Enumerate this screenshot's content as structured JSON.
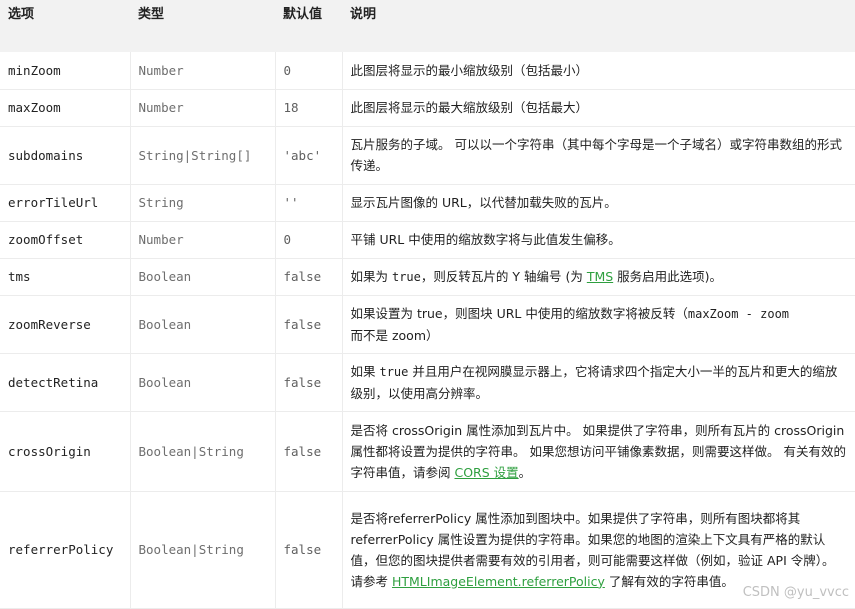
{
  "headers": {
    "option": "选项",
    "type": "类型",
    "default": "默认值",
    "description": "说明"
  },
  "rows": [
    {
      "option": "minZoom",
      "type": "Number",
      "default": "0",
      "description": "此图层将显示的最小缩放级别（包括最小）"
    },
    {
      "option": "maxZoom",
      "type": "Number",
      "default": "18",
      "description": "此图层将显示的最大缩放级别（包括最大）"
    },
    {
      "option": "subdomains",
      "type": "String|String[]",
      "default": "'abc'",
      "description": "瓦片服务的子域。 可以以一个字符串（其中每个字母是一个子域名）或字符串数组的形式传递。"
    },
    {
      "option": "errorTileUrl",
      "type": "String",
      "default": "''",
      "description": "显示瓦片图像的 URL，以代替加载失败的瓦片。"
    },
    {
      "option": "zoomOffset",
      "type": "Number",
      "default": "0",
      "description": "平铺 URL 中使用的缩放数字将与此值发生偏移。"
    },
    {
      "option": "tms",
      "type": "Boolean",
      "default": "false",
      "desc_a": "如果为 ",
      "desc_code": "true",
      "desc_b": "，则反转瓦片的 Y 轴编号 (为 ",
      "desc_link": "TMS",
      "desc_c": " 服务启用此选项)。"
    },
    {
      "option": "zoomReverse",
      "type": "Boolean",
      "default": "false",
      "desc_a": "如果设置为 true，则图块 URL 中使用的缩放数字将被反转（",
      "desc_code": "maxZoom - zoom",
      "desc_b": "而不是 zoom）"
    },
    {
      "option": "detectRetina",
      "type": "Boolean",
      "default": "false",
      "desc_a": "如果 ",
      "desc_code": "true",
      "desc_b": " 并且用户在视网膜显示器上，它将请求四个指定大小一半的瓦片和更大的缩放级别，以使用高分辨率。"
    },
    {
      "option": "crossOrigin",
      "type": "Boolean|String",
      "default": "false",
      "desc_a": "是否将 crossOrigin 属性添加到瓦片中。 如果提供了字符串，则所有瓦片的 crossOrigin 属性都将设置为提供的字符串。 如果您想访问平铺像素数据，则需要这样做。 有关有效的字符串值，请参阅 ",
      "desc_link": "CORS 设置",
      "desc_b": "。"
    },
    {
      "option": "referrerPolicy",
      "type": "Boolean|String",
      "default": "false",
      "desc_a": "是否将referrerPolicy 属性添加到图块中。如果提供了字符串，则所有图块都将其 referrerPolicy 属性设置为提供的字符串。如果您的地图的渲染上下文具有严格的默认值，但您的图块提供者需要有效的引用者，则可能需要这样做（例如，验证 API 令牌）。 请参考 ",
      "desc_link": "HTMLImageElement.referrerPolicy",
      "desc_b": " 了解有效的字符串值。"
    }
  ],
  "watermark": "CSDN @yu_vvcc",
  "colors": {
    "header_bg": "#f2f2f2",
    "link": "#2e9f3f",
    "type_text": "#6e6e6e"
  }
}
